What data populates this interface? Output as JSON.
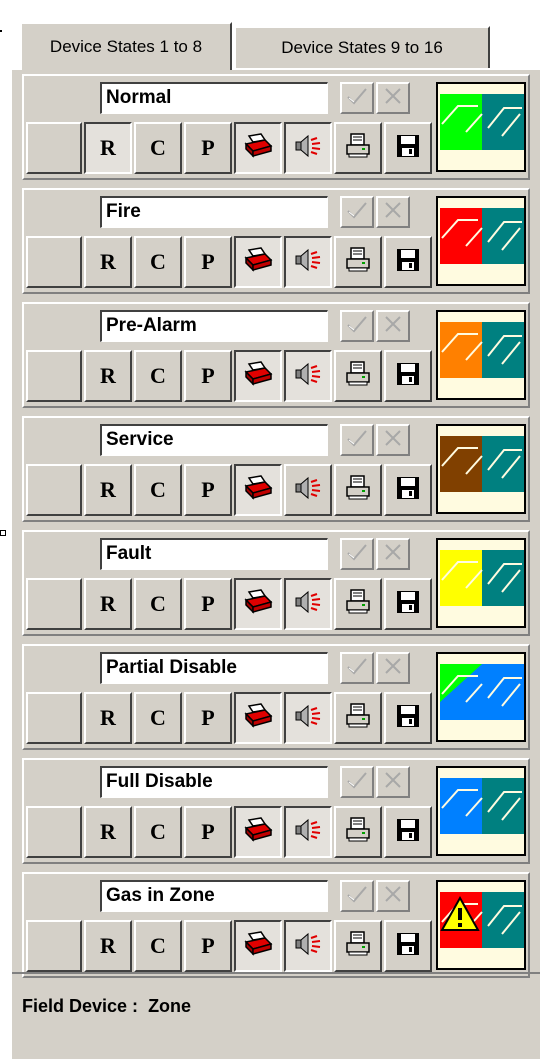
{
  "tabs": [
    {
      "label": "Device States 1 to 8"
    },
    {
      "label": "Device States 9 to 16"
    }
  ],
  "buttons": {
    "r_label": "R",
    "c_label": "C",
    "p_label": "P",
    "ok_icon": "checkmark-icon",
    "cancel_icon": "x-icon",
    "print_icon": "printer-icon",
    "sound_icon": "speaker-icon",
    "printer2_icon": "report-printer-icon",
    "save_icon": "floppy-disk-icon"
  },
  "states": [
    {
      "name": "Normal",
      "primary_color": "#00ff00",
      "secondary_color": "#008080",
      "preview": "split"
    },
    {
      "name": "Fire",
      "primary_color": "#ff0000",
      "secondary_color": "#008080",
      "preview": "split"
    },
    {
      "name": "Pre-Alarm",
      "primary_color": "#ff8000",
      "secondary_color": "#008080",
      "preview": "split"
    },
    {
      "name": "Service",
      "primary_color": "#804000",
      "secondary_color": "#008080",
      "preview": "split"
    },
    {
      "name": "Fault",
      "primary_color": "#ffff00",
      "secondary_color": "#008080",
      "preview": "split"
    },
    {
      "name": "Partial Disable",
      "primary_color": "#00ff00",
      "secondary_color": "#0080ff",
      "preview": "diagonal"
    },
    {
      "name": "Full Disable",
      "primary_color": "#0080ff",
      "secondary_color": "#008080",
      "preview": "split"
    },
    {
      "name": "Gas in Zone",
      "primary_color": "#ff0000",
      "secondary_color": "#008080",
      "preview": "warning",
      "warning_color": "#ffff00"
    }
  ],
  "footer": {
    "label": "Field Device :",
    "value": "Zone"
  }
}
